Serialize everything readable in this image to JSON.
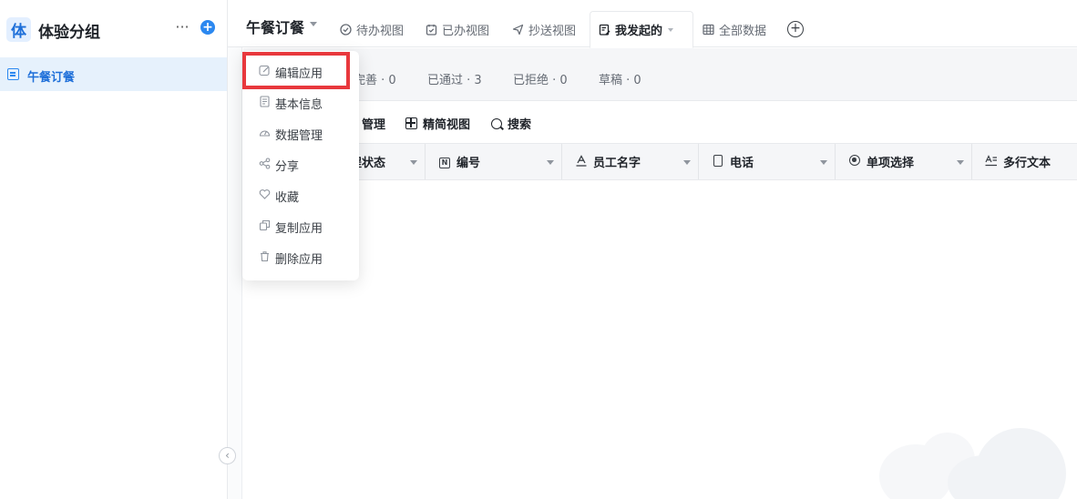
{
  "sidebar": {
    "group_avatar": "体",
    "group_title": "体验分组",
    "more_label": "···",
    "add_label": "+",
    "items": [
      {
        "label": "午餐订餐",
        "icon": "form-icon"
      }
    ],
    "collapse_label": "‹"
  },
  "header": {
    "app_title": "午餐订餐",
    "tabs": [
      {
        "label": "待办视图",
        "icon": "check-circle-icon"
      },
      {
        "label": "已办视图",
        "icon": "calendar-check-icon"
      },
      {
        "label": "抄送视图",
        "icon": "send-icon"
      },
      {
        "label": "我发起的",
        "icon": "form-edit-icon",
        "active": true
      },
      {
        "label": "全部数据",
        "icon": "table-icon"
      }
    ],
    "add_tab_label": "+"
  },
  "filters": [
    {
      "label": "完善 · 0"
    },
    {
      "label": "已通过 · 3"
    },
    {
      "label": "已拒绝 · 0"
    },
    {
      "label": "草稿 · 0"
    }
  ],
  "toolbar": {
    "manage_label": "管理",
    "compact_view_label": "精简视图",
    "search_label": "搜索"
  },
  "table": {
    "columns": [
      {
        "label": "程状态",
        "icon": ""
      },
      {
        "label": "编号",
        "icon": "number-icon"
      },
      {
        "label": "员工名字",
        "icon": "text-icon"
      },
      {
        "label": "电话",
        "icon": "phone-icon"
      },
      {
        "label": "单项选择",
        "icon": "radio-icon"
      },
      {
        "label": "多行文本",
        "icon": "multiline-text-icon"
      }
    ]
  },
  "dropdown": {
    "items": [
      {
        "label": "编辑应用",
        "icon": "edit-icon"
      },
      {
        "label": "基本信息",
        "icon": "info-doc-icon"
      },
      {
        "label": "数据管理",
        "icon": "dashboard-icon"
      },
      {
        "label": "分享",
        "icon": "share-icon"
      },
      {
        "label": "收藏",
        "icon": "heart-icon"
      },
      {
        "label": "复制应用",
        "icon": "copy-icon"
      },
      {
        "label": "删除应用",
        "icon": "trash-icon"
      }
    ]
  },
  "colors": {
    "accent": "#2b88f0",
    "highlight": "#e8383d",
    "sidebar_active_bg": "#e6f1fc"
  }
}
